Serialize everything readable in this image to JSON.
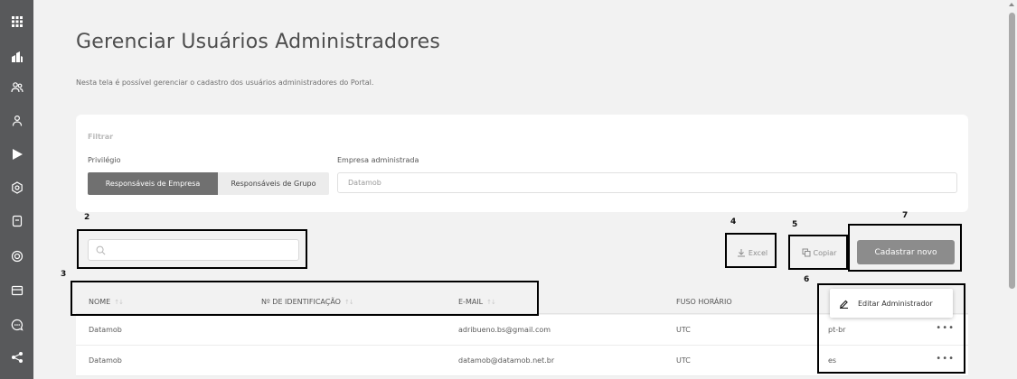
{
  "page": {
    "title": "Gerenciar Usuários Administradores",
    "description": "Nesta tela é possível gerenciar o cadastro dos usuários administradores do Portal."
  },
  "sidebar": {
    "icons": [
      "apps-grid-icon",
      "company-icon",
      "users-icon",
      "user-icon",
      "play-icon",
      "settings-icon",
      "device-icon",
      "target-icon",
      "card-icon",
      "chat-icon",
      "share-icon"
    ]
  },
  "filter": {
    "title": "Filtrar",
    "privilege_label": "Privilégio",
    "privilege_options": [
      "Responsáveis de Empresa",
      "Responsáveis de Grupo"
    ],
    "selected_privilege": "Responsáveis de Empresa",
    "company_label": "Empresa administrada",
    "company_value": "Datamob"
  },
  "search": {
    "placeholder": "",
    "value": ""
  },
  "actions": {
    "excel_label": "Excel",
    "copy_label": "Copiar",
    "new_label": "Cadastrar novo"
  },
  "annotations": [
    "2",
    "3",
    "4",
    "5",
    "6",
    "7"
  ],
  "table": {
    "columns": [
      "NOME",
      "Nº DE IDENTIFICAÇÃO",
      "E-MAIL",
      "FUSO HORÁRIO"
    ],
    "rows": [
      {
        "name": "Datamob",
        "id": "",
        "email": "adribueno.bs@gmail.com",
        "timezone": "UTC",
        "lang": "pt-br"
      },
      {
        "name": "Datamob",
        "id": "",
        "email": "datamob@datamob.net.br",
        "timezone": "UTC",
        "lang": "es"
      }
    ],
    "row_menu_label": "•••"
  },
  "dropdown": {
    "edit_label": "Editar Administrador"
  },
  "colors": {
    "sidebar": "#58595b",
    "primary_button": "#8c8c8c",
    "background": "#f2f2f2"
  }
}
